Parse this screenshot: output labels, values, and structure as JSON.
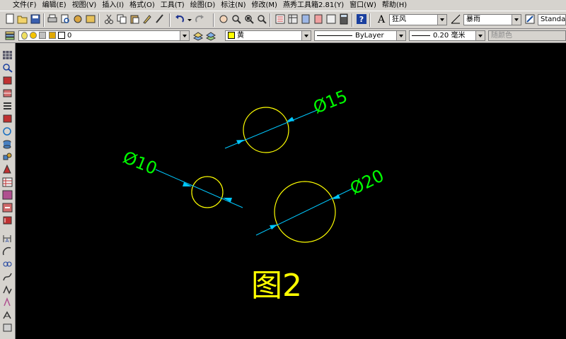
{
  "menu": {
    "items": [
      "文件(F)",
      "编辑(E)",
      "视图(V)",
      "插入(I)",
      "格式(O)",
      "工具(T)",
      "绘图(D)",
      "标注(N)",
      "修改(M)",
      "燕秀工具箱2.81(Y)",
      "窗口(W)",
      "帮助(H)"
    ]
  },
  "toolbar": {
    "text_style": "狂风",
    "dim_style": "暴雨",
    "table_style": "Standard",
    "layer": "0",
    "color": "黄",
    "linetype": "ByLayer",
    "lineweight": "0.20 毫米",
    "plot_style": "随颜色"
  },
  "drawing": {
    "labels": {
      "d10": "Ø10",
      "d15": "Ø15",
      "d20": "Ø20"
    },
    "caption": "图2",
    "colors": {
      "circle": "#ffff00",
      "dimension_line": "#00c8ff",
      "dimension_text": "#00ff00",
      "caption": "#ffff00"
    }
  }
}
